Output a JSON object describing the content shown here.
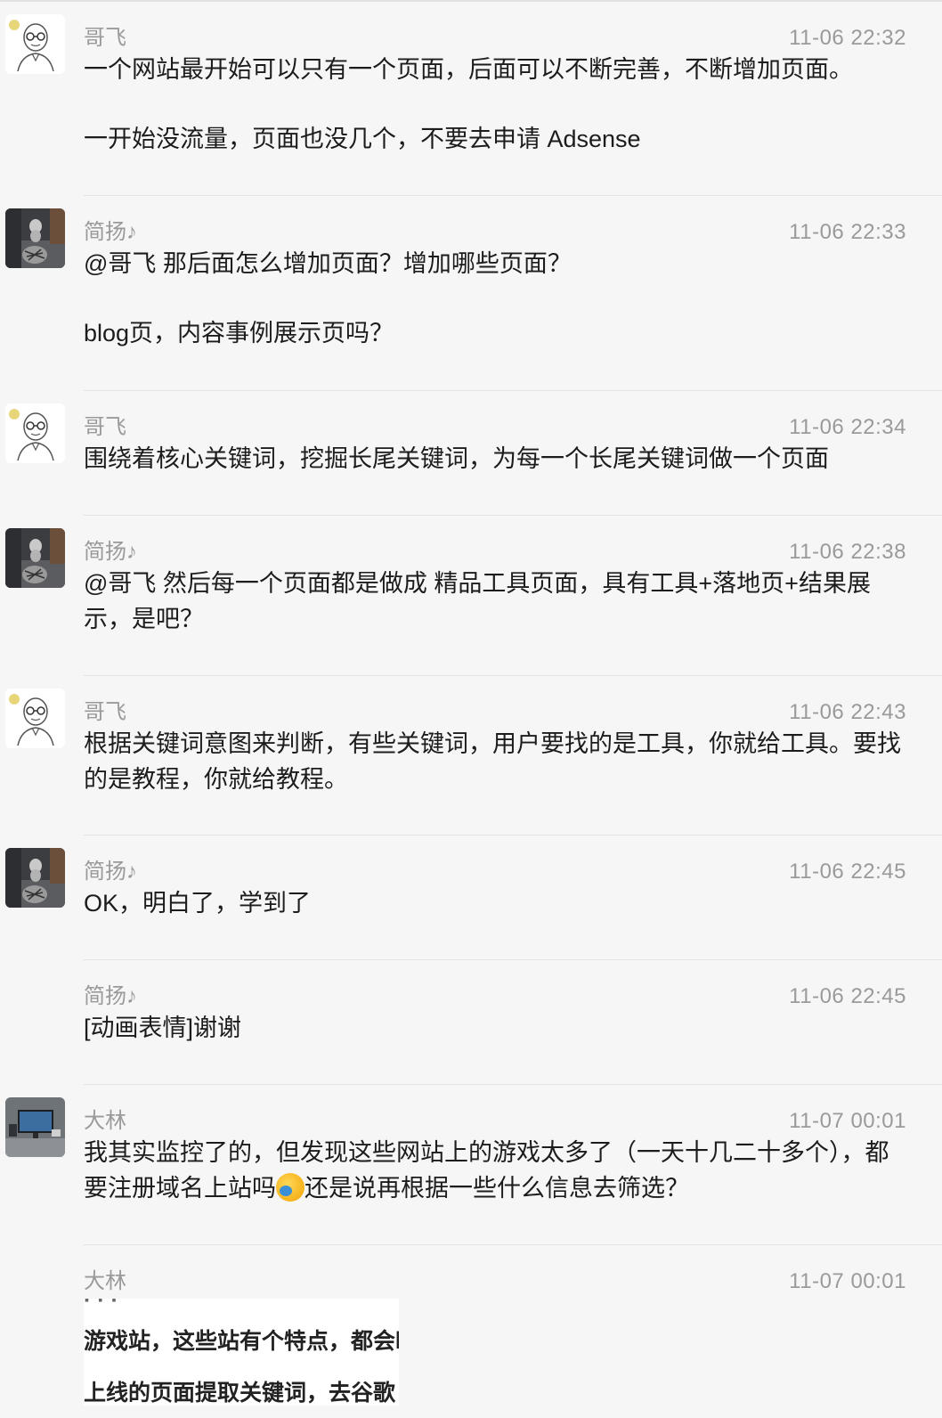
{
  "messages": [
    {
      "sender": "哥飞",
      "time": "11-06 22:32",
      "avatar": "bald-glasses-cartoon",
      "paragraphs": [
        "一个网站最开始可以只有一个页面，后面可以不断完善，不断增加页面。",
        "一开始没流量，页面也没几个，不要去申请 Adsense"
      ]
    },
    {
      "sender": "简扬♪",
      "time": "11-06 22:33",
      "avatar": "cat-tiger-reflection",
      "paragraphs": [
        "@哥飞 那后面怎么增加页面？增加哪些页面？",
        "blog页，内容事例展示页吗？"
      ]
    },
    {
      "sender": "哥飞",
      "time": "11-06 22:34",
      "avatar": "bald-glasses-cartoon",
      "paragraphs": [
        "围绕着核心关键词，挖掘长尾关键词，为每一个长尾关键词做一个页面"
      ]
    },
    {
      "sender": "简扬♪",
      "time": "11-06 22:38",
      "avatar": "cat-tiger-reflection",
      "paragraphs": [
        "@哥飞 然后每一个页面都是做成 精品工具页面，具有工具+落地页+结果展示，是吧？"
      ]
    },
    {
      "sender": "哥飞",
      "time": "11-06 22:43",
      "avatar": "bald-glasses-cartoon",
      "paragraphs": [
        "根据关键词意图来判断，有些关键词，用户要找的是工具，你就给工具。要找的是教程，你就给教程。"
      ]
    },
    {
      "sender": "简扬♪",
      "time": "11-06 22:45",
      "avatar": "cat-tiger-reflection",
      "paragraphs": [
        "OK，明白了，学到了"
      ]
    },
    {
      "sender": "简扬♪",
      "time": "11-06 22:45",
      "avatar": "",
      "paragraphs": [
        "[动画表情]谢谢"
      ]
    },
    {
      "sender": "大林",
      "time": "11-07 00:01",
      "avatar": "desk-monitor-photo",
      "paragraphs": [
        "我其实监控了的，但发现这些网站上的游戏太多了（一天十几二十多个），都要注册域名上站吗",
        "还是说再根据一些什么信息去筛选？"
      ],
      "emoji": "crying-laughing-emoji"
    },
    {
      "sender": "大林",
      "time": "11-07 00:01",
      "avatar": "",
      "image_text": [
        "游戏站，这些站有个特点，都会时",
        "上线的页面提取关键词，去谷歌"
      ]
    }
  ]
}
